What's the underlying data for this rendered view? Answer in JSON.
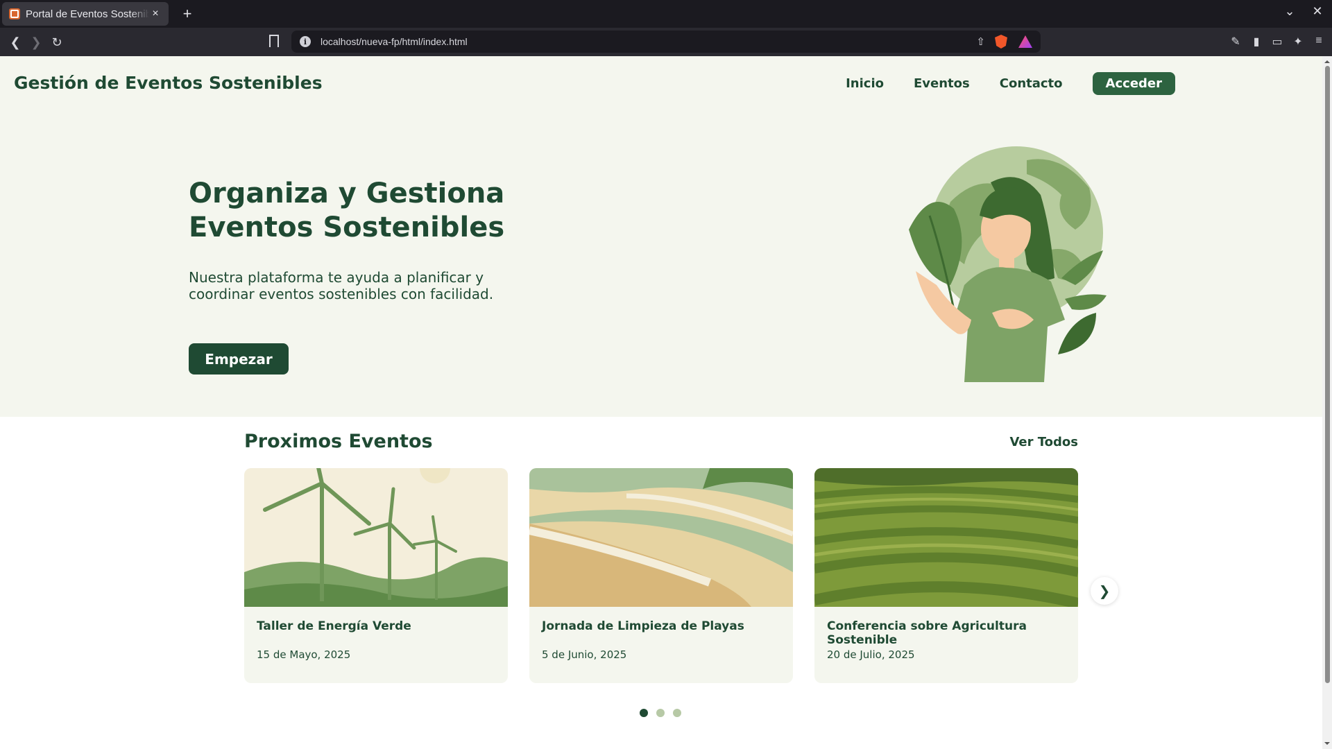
{
  "browser": {
    "tab_title": "Portal de Eventos Sostenibles",
    "tab_close": "×",
    "new_tab": "+",
    "url": "localhost/nueva-fp/html/index.html",
    "url_info": "i"
  },
  "site": {
    "title": "Gestión de Eventos Sostenibles",
    "nav": {
      "inicio": "Inicio",
      "eventos": "Eventos",
      "contacto": "Contacto",
      "acceder": "Acceder"
    }
  },
  "hero": {
    "heading": "Organiza y Gestiona Eventos Sostenibles",
    "text": "Nuestra plataforma te ayuda a planificar y coordinar eventos sostenibles con facilidad.",
    "cta": "Empezar"
  },
  "events": {
    "title": "Proximos Eventos",
    "see_all": "Ver Todos",
    "next": "❯",
    "items": [
      {
        "title": "Taller de Energía Verde",
        "date": "15 de Mayo, 2025"
      },
      {
        "title": "Jornada de Limpieza de Playas",
        "date": "5 de Junio, 2025"
      },
      {
        "title": "Conferencia sobre Agricultura Sostenible",
        "date": "20 de Julio, 2025"
      }
    ],
    "carousel_pages": 3,
    "active_page": 1
  },
  "colors": {
    "brand_dark": "#1f4a33",
    "brand": "#2d6340",
    "hero_bg": "#f4f6ee"
  }
}
